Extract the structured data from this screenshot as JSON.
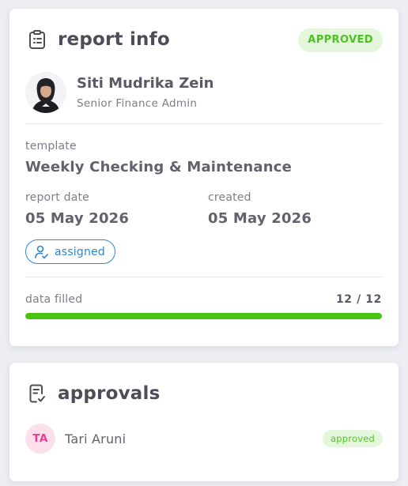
{
  "report_info": {
    "title": "report info",
    "icon": "clipboard-icon",
    "status": "APPROVED",
    "user": {
      "name": "Siti Mudrika Zein",
      "role": "Senior Finance Admin"
    },
    "template_label": "template",
    "template_value": "Weekly Checking & Maintenance",
    "report_date_label": "report date",
    "report_date_value": "05 May 2026",
    "created_label": "created",
    "created_value": "05 May 2026",
    "assigned_label": "assigned",
    "data_filled_label": "data filled",
    "data_filled_count": "12 / 12",
    "data_filled_fraction": 1.0
  },
  "approvals": {
    "title": "approvals",
    "icon": "checklist-document-icon",
    "items": [
      {
        "initials": "TA",
        "name": "Tari Aruni",
        "status": "approved"
      }
    ]
  },
  "colors": {
    "approved_green": "#49c40e",
    "approved_bg": "#e4f6dc",
    "assigned_blue": "#2d86d2",
    "initials_pink": "#ea3f8c",
    "initials_bg": "#fbe0ec"
  }
}
